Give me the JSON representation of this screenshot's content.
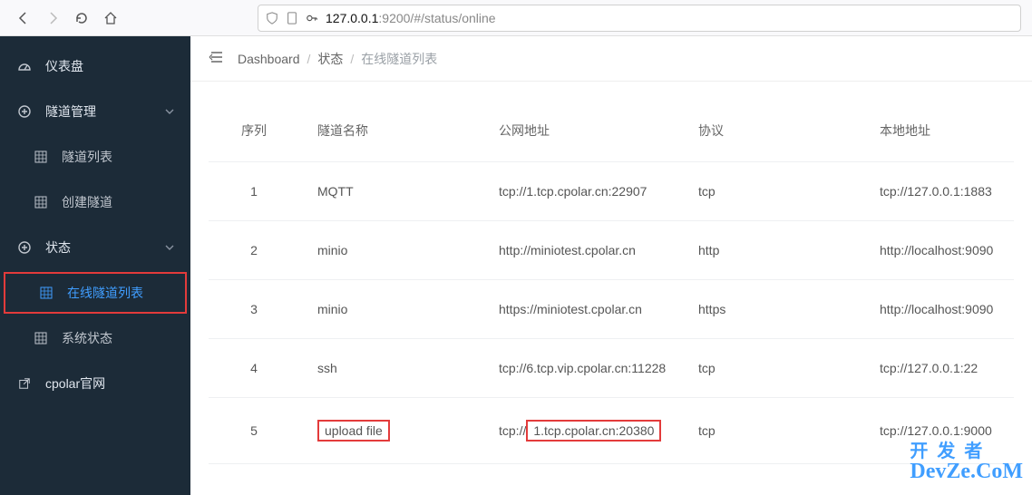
{
  "browser": {
    "url_prefix": "127.0.0.1",
    "url_suffix": ":9200/#/status/online"
  },
  "sidebar": {
    "dashboard": "仪表盘",
    "tunnel_mgmt": "隧道管理",
    "tunnel_list": "隧道列表",
    "create_tunnel": "创建隧道",
    "status": "状态",
    "online_list": "在线隧道列表",
    "system_status": "系统状态",
    "cpolar_site": "cpolar官网"
  },
  "breadcrumb": {
    "dashboard": "Dashboard",
    "status": "状态",
    "online": "在线隧道列表"
  },
  "table": {
    "headers": {
      "idx": "序列",
      "name": "隧道名称",
      "public": "公网地址",
      "proto": "协议",
      "local": "本地地址"
    },
    "rows": [
      {
        "idx": "1",
        "name": "MQTT",
        "public": "tcp://1.tcp.cpolar.cn:22907",
        "proto": "tcp",
        "local": "tcp://127.0.0.1:1883",
        "hl_name": false,
        "hl_public": false
      },
      {
        "idx": "2",
        "name": "minio",
        "public": "http://miniotest.cpolar.cn",
        "proto": "http",
        "local": "http://localhost:9090",
        "hl_name": false,
        "hl_public": false
      },
      {
        "idx": "3",
        "name": "minio",
        "public": "https://miniotest.cpolar.cn",
        "proto": "https",
        "local": "http://localhost:9090",
        "hl_name": false,
        "hl_public": false
      },
      {
        "idx": "4",
        "name": "ssh",
        "public": "tcp://6.tcp.vip.cpolar.cn:11228",
        "proto": "tcp",
        "local": "tcp://127.0.0.1:22",
        "hl_name": false,
        "hl_public": false
      },
      {
        "idx": "5",
        "name": "upload file",
        "public_pre": "tcp://",
        "public_hl": "1.tcp.cpolar.cn:20380",
        "proto": "tcp",
        "local": "tcp://127.0.0.1:9000",
        "hl_name": true,
        "hl_public": true
      }
    ]
  },
  "watermark": {
    "l1": "开发者",
    "l2": "DevZe.CoM"
  }
}
